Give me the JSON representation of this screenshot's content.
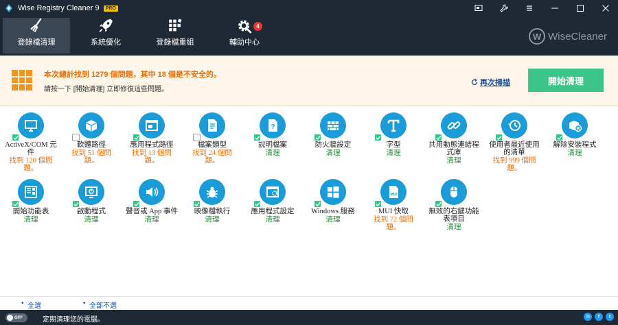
{
  "window": {
    "title": "Wise Registry Cleaner 9",
    "badge": "PRO"
  },
  "nav": {
    "tabs": [
      {
        "label": "登錄檔清理",
        "icon": "broom-icon",
        "active": true
      },
      {
        "label": "系統優化",
        "icon": "rocket-icon",
        "active": false
      },
      {
        "label": "登錄檔重組",
        "icon": "defrag-icon",
        "active": false
      },
      {
        "label": "輔助中心",
        "icon": "gear-icon",
        "active": false,
        "badge": "4"
      }
    ],
    "brand": "WiseCleaner",
    "brand_logo": "W"
  },
  "banner": {
    "summary": "本次總計找到 1279 個問題，其中 18 個是不安全的。",
    "hint": "請按一下 [開始清理] 立即修復這些問題。",
    "rescan": "再次掃描",
    "start": "開始清理"
  },
  "items": [
    {
      "name": "ActiveX/COM 元件",
      "status": "找到 120 個問題。",
      "kind": "issue",
      "icon": "monitor-icon",
      "checked": true
    },
    {
      "name": "軟體路徑",
      "status": "找到 51 個問題。",
      "kind": "issue",
      "icon": "box-icon",
      "checked": false
    },
    {
      "name": "應用程式路徑",
      "status": "找到 13 個問題。",
      "kind": "issue",
      "icon": "window-icon",
      "checked": true
    },
    {
      "name": "檔案類型",
      "status": "找到 24 個問題。",
      "kind": "issue",
      "icon": "document-icon",
      "checked": false
    },
    {
      "name": "說明檔案",
      "status": "清理",
      "kind": "ok",
      "icon": "help-file-icon",
      "checked": true
    },
    {
      "name": "防火牆設定",
      "status": "清理",
      "kind": "ok",
      "icon": "firewall-icon",
      "checked": true
    },
    {
      "name": "字型",
      "status": "清理",
      "kind": "ok",
      "icon": "font-icon",
      "checked": true
    },
    {
      "name": "共用動態連結程式庫",
      "status": "清理",
      "kind": "ok",
      "icon": "link-icon",
      "checked": true
    },
    {
      "name": "使用者最近使用的清單",
      "status": "找到 999 個問題。",
      "kind": "issue",
      "icon": "history-icon",
      "checked": true
    },
    {
      "name": "解除安裝程式",
      "status": "清理",
      "kind": "ok",
      "icon": "uninstall-icon",
      "checked": true
    },
    {
      "name": "開始功能表",
      "status": "清理",
      "kind": "ok",
      "icon": "start-menu-icon",
      "checked": true
    },
    {
      "name": "啟動程式",
      "status": "清理",
      "kind": "ok",
      "icon": "startup-icon",
      "checked": true
    },
    {
      "name": "聲音或 App 事件",
      "status": "清理",
      "kind": "ok",
      "icon": "speaker-icon",
      "checked": true
    },
    {
      "name": "映像檔執行",
      "status": "清理",
      "kind": "ok",
      "icon": "bug-icon",
      "checked": true
    },
    {
      "name": "應用程式設定",
      "status": "清理",
      "kind": "ok",
      "icon": "app-settings-icon",
      "checked": true
    },
    {
      "name": "Windows 服務",
      "status": "清理",
      "kind": "ok",
      "icon": "windows-icon",
      "checked": true
    },
    {
      "name": "MUI 快取",
      "status": "找到 72 個問題。",
      "kind": "issue",
      "icon": "mui-icon",
      "checked": true
    },
    {
      "name": "無效的右鍵功能表項目",
      "status": "清理",
      "kind": "ok",
      "icon": "mouse-icon",
      "checked": true
    }
  ],
  "select": {
    "all": "全選",
    "none": "全部不選"
  },
  "status": {
    "toggle": "OFF",
    "schedule": "定期清理您的電腦。"
  },
  "colors": {
    "accent": "#1a9cd8",
    "start_button": "#3cc58a",
    "issue_text": "#e8700c",
    "ok_text": "#2d8a3e",
    "chrome": "#1e2935"
  }
}
